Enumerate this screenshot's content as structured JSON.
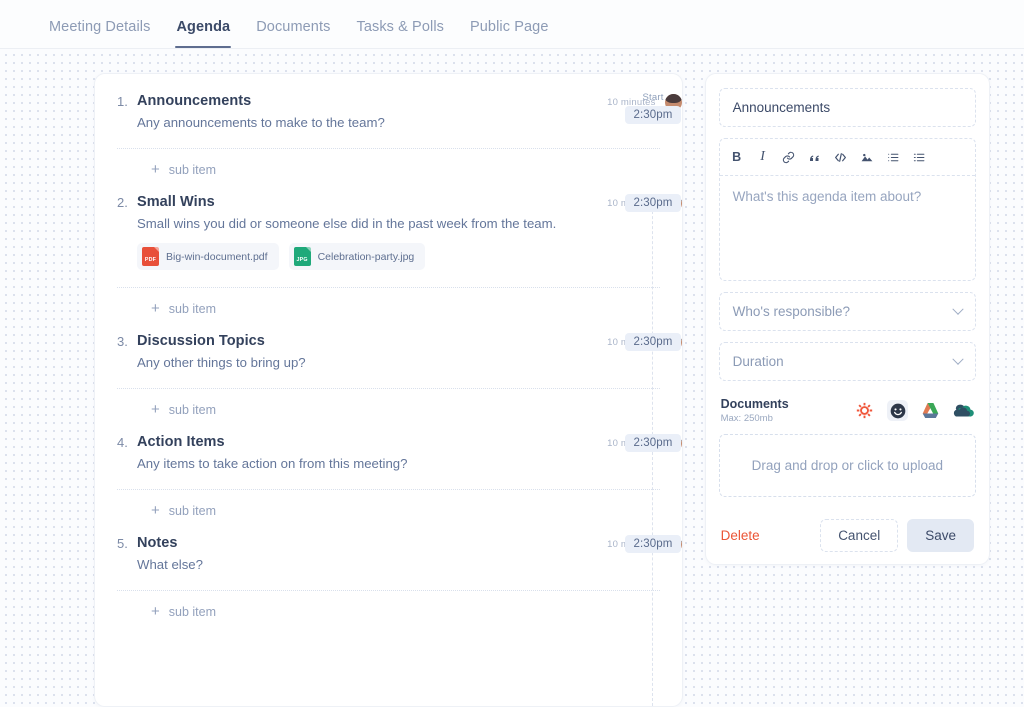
{
  "tabs": [
    {
      "label": "Meeting Details",
      "active": false
    },
    {
      "label": "Agenda",
      "active": true
    },
    {
      "label": "Documents",
      "active": false
    },
    {
      "label": "Tasks & Polls",
      "active": false
    },
    {
      "label": "Public Page",
      "active": false
    }
  ],
  "agenda": {
    "start_label": "Start",
    "sub_item_label": "sub item",
    "items": [
      {
        "number": "1.",
        "title": "Announcements",
        "description": "Any announcements to make to the team?",
        "duration": "10 minutes",
        "time": "2:30pm",
        "attachments": []
      },
      {
        "number": "2.",
        "title": "Small Wins",
        "description": "Small wins you did or someone else did in the past week from the team.",
        "duration": "10 minutes",
        "time": "2:30pm",
        "attachments": [
          {
            "name": "Big-win-document.pdf",
            "ext": "PDF",
            "kind": "pdf"
          },
          {
            "name": "Celebration-party.jpg",
            "ext": "JPG",
            "kind": "jpg"
          }
        ]
      },
      {
        "number": "3.",
        "title": "Discussion Topics",
        "description": "Any other things to bring up?",
        "duration": "10 minutes",
        "time": "2:30pm",
        "attachments": []
      },
      {
        "number": "4.",
        "title": "Action Items",
        "description": "Any items to take action on from this meeting?",
        "duration": "10 minutes",
        "time": "2:30pm",
        "attachments": []
      },
      {
        "number": "5.",
        "title": "Notes",
        "description": "What else?",
        "duration": "10 minutes",
        "time": "2:30pm",
        "attachments": []
      }
    ]
  },
  "editor": {
    "title_value": "Announcements",
    "description_placeholder": "What's this agenda item about?",
    "toolbar": [
      {
        "name": "bold-icon",
        "label": "B"
      },
      {
        "name": "italic-icon",
        "label": "I"
      },
      {
        "name": "link-icon",
        "label": "link"
      },
      {
        "name": "quote-icon",
        "label": "”"
      },
      {
        "name": "code-icon",
        "label": "</>"
      },
      {
        "name": "image-icon",
        "label": "image"
      },
      {
        "name": "ordered-list-icon",
        "label": "ol"
      },
      {
        "name": "bullet-list-icon",
        "label": "ul"
      }
    ],
    "responsible_placeholder": "Who's responsible?",
    "duration_placeholder": "Duration",
    "documents_label": "Documents",
    "documents_max": "Max: 250mb",
    "cloud_sources": [
      {
        "name": "asana-icon",
        "color": "#f0573b"
      },
      {
        "name": "dropbox-icon",
        "color": "#2d3748"
      },
      {
        "name": "google-drive-icon",
        "color": "#3aa757"
      },
      {
        "name": "onedrive-icon",
        "color": "#2b4a63"
      }
    ],
    "dropzone_text": "Drag and drop or click to upload",
    "delete_label": "Delete",
    "cancel_label": "Cancel",
    "save_label": "Save"
  },
  "colors": {
    "accent": "#5e6d8f",
    "delete": "#eb5536",
    "pdf": "#e8503a",
    "jpg": "#1fa97a",
    "chip_bg": "#eaeff8"
  }
}
